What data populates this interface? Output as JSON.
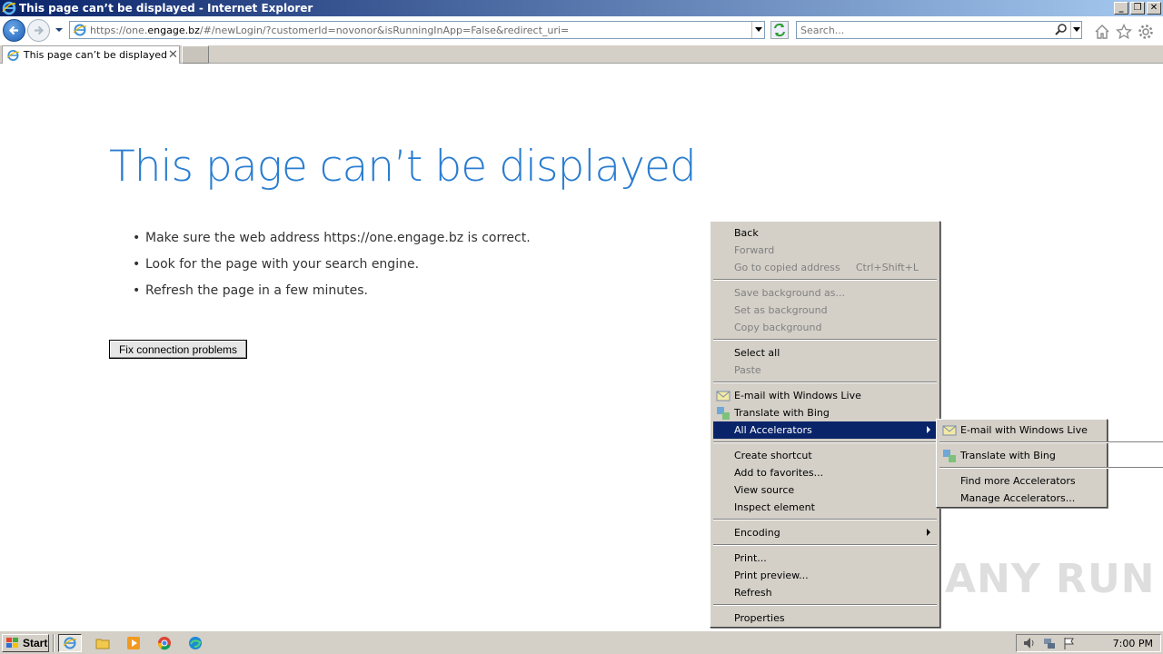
{
  "window": {
    "title": "This page can’t be displayed - Internet Explorer",
    "min": "_",
    "restore": "❐",
    "close": "✕"
  },
  "addressbar": {
    "url_prefix": "https://one.",
    "url_domain": "engage.bz",
    "url_rest": "/#/newLogin/?customerId=novonor&isRunningInApp=False&redirect_uri=",
    "search_placeholder": "Search..."
  },
  "tab": {
    "label": "This page can’t be displayed",
    "close": "✕"
  },
  "content": {
    "heading": "This page can’t be displayed",
    "tips": [
      "Make sure the web address https://one.engage.bz is correct.",
      "Look for the page with your search engine.",
      "Refresh the page in a few minutes."
    ],
    "bullet": "•",
    "fix_button": "Fix connection problems"
  },
  "context_menu": {
    "back": "Back",
    "forward": "Forward",
    "go_to_copied": "Go to copied address",
    "go_to_copied_shortcut": "Ctrl+Shift+L",
    "save_background": "Save background as...",
    "set_background": "Set as background",
    "copy_background": "Copy background",
    "select_all": "Select all",
    "paste": "Paste",
    "email_live": "E-mail with Windows Live",
    "translate_bing": "Translate with Bing",
    "all_accelerators": "All Accelerators",
    "create_shortcut": "Create shortcut",
    "add_favorites": "Add to favorites...",
    "view_source": "View source",
    "inspect_element": "Inspect element",
    "encoding": "Encoding",
    "print": "Print...",
    "print_preview": "Print preview...",
    "refresh": "Refresh",
    "properties": "Properties"
  },
  "submenu": {
    "email_live": "E-mail with Windows Live",
    "translate_bing": "Translate with Bing",
    "find_more": "Find more Accelerators",
    "manage": "Manage Accelerators..."
  },
  "watermark": "ANY RUN",
  "taskbar": {
    "start": "Start",
    "clock": "7:00 PM"
  },
  "colors": {
    "heading_blue": "#2a7dd1",
    "menu_highlight": "#0a246a",
    "chrome_gray": "#d4d0c8"
  }
}
